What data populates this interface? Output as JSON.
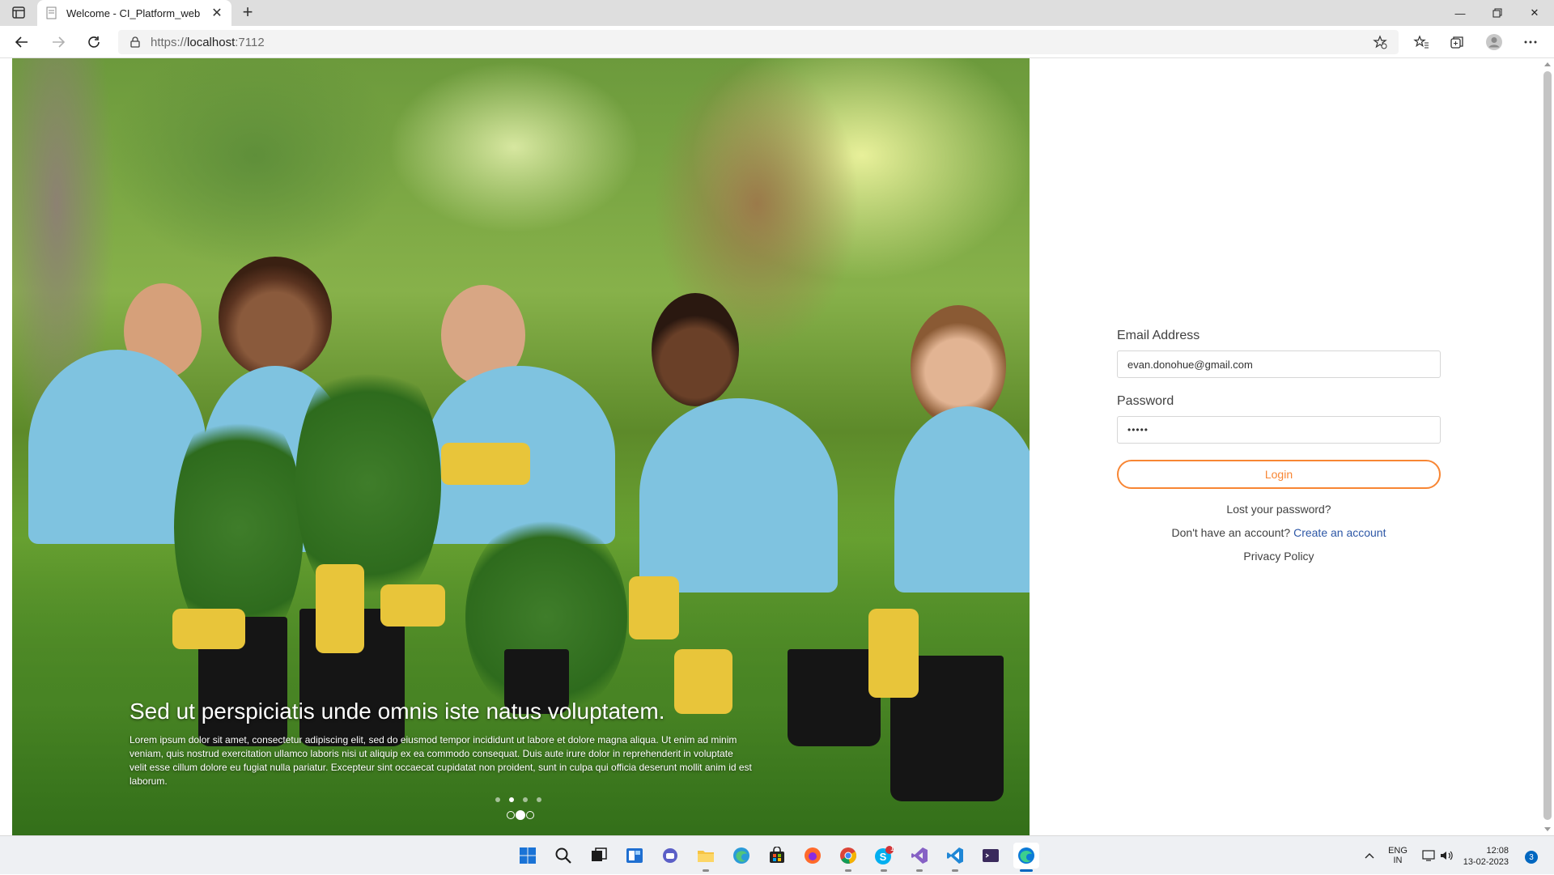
{
  "browser": {
    "tab_title": "Welcome - CI_Platform_web",
    "url_scheme": "https://",
    "url_host": "localhost",
    "url_rest": ":7112"
  },
  "hero": {
    "headline": "Sed ut perspiciatis unde omnis iste natus voluptatem.",
    "body": "Lorem ipsum dolor sit amet, consectetur adipiscing elit, sed do eiusmod tempor incididunt ut labore et dolore magna aliqua. Ut enim ad minim veniam, quis nostrud exercitation ullamco laboris nisi ut aliquip ex ea commodo consequat. Duis aute irure dolor in reprehenderit in voluptate velit esse cillum dolore eu fugiat nulla pariatur. Excepteur sint occaecat cupidatat non proident, sunt in culpa qui officia deserunt mollit anim id est laborum.",
    "slide_indicator_count": 4,
    "active_slide": 2
  },
  "login": {
    "email_label": "Email Address",
    "email_value": "evan.donohue@gmail.com",
    "password_label": "Password",
    "password_value": "•••••",
    "login_button": "Login",
    "lost_password": "Lost your password?",
    "no_account_text": "Don't have an account?",
    "create_account": "Create an account",
    "privacy_policy": "Privacy Policy"
  },
  "taskbar": {
    "language_line1": "ENG",
    "language_line2": "IN",
    "time": "12:08",
    "date": "13-02-2023",
    "notification_count": "3",
    "skype_badge": "1"
  },
  "colors": {
    "accent_orange": "#f88634",
    "link_blue": "#2d57a6"
  }
}
